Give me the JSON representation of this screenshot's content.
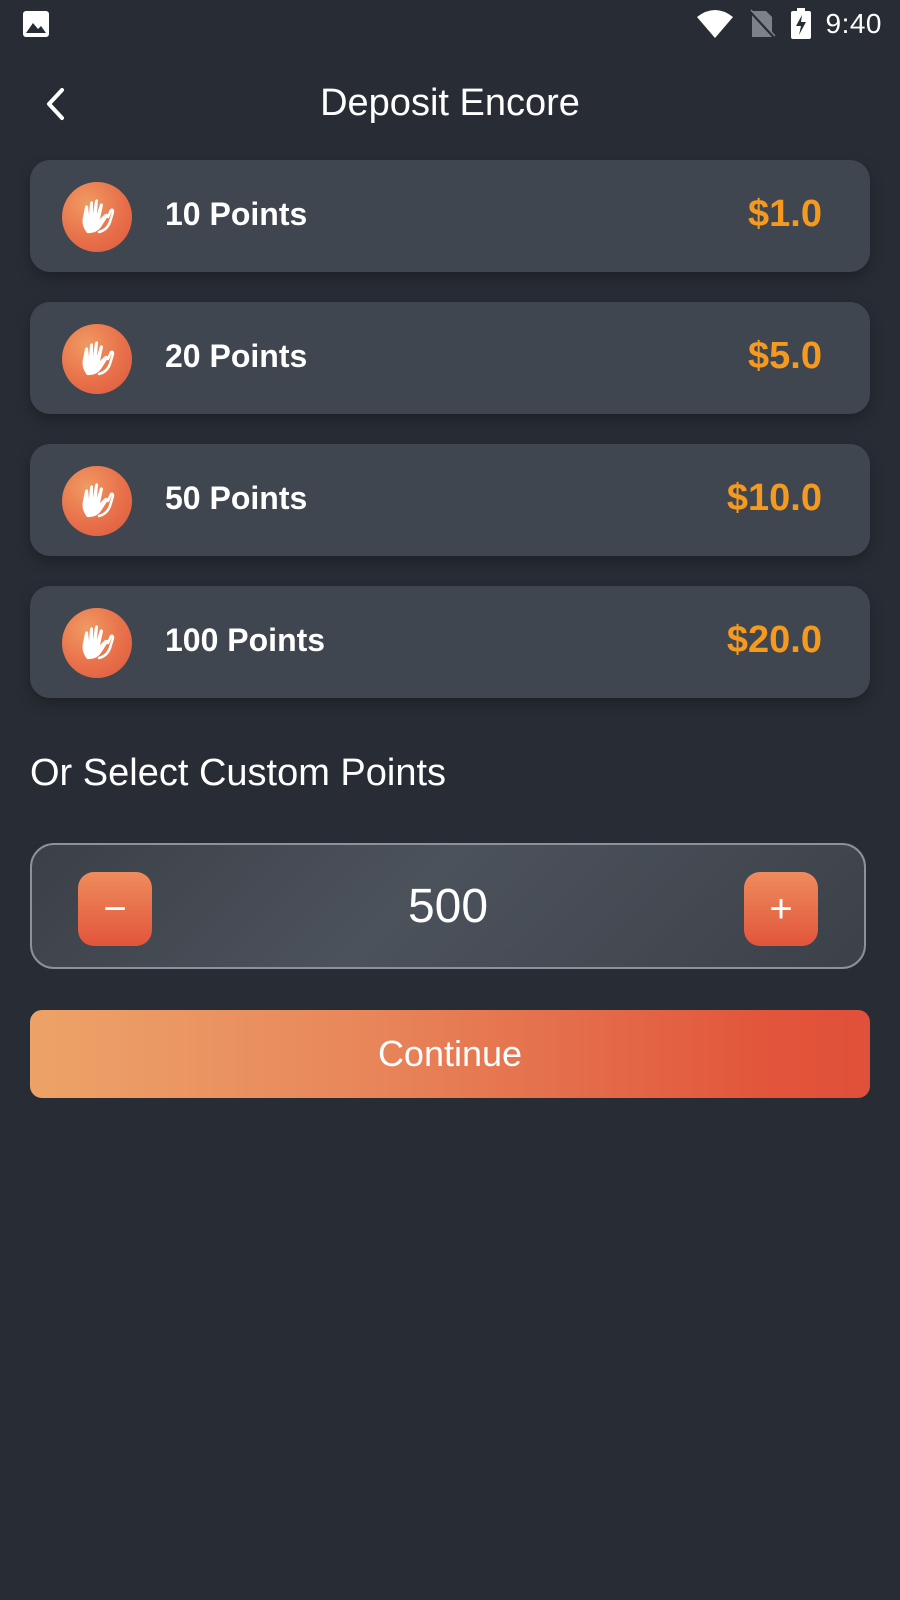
{
  "status_bar": {
    "time": "9:40",
    "left_icon": "image-icon",
    "icons": [
      "wifi-icon",
      "no-sim-icon",
      "battery-charging-icon"
    ]
  },
  "header": {
    "title": "Deposit Encore",
    "back_icon": "chevron-left-icon"
  },
  "packages": [
    {
      "label": "10 Points",
      "price": "$1.0",
      "icon": "clapping-hands-icon"
    },
    {
      "label": "20 Points",
      "price": "$5.0",
      "icon": "clapping-hands-icon"
    },
    {
      "label": "50 Points",
      "price": "$10.0",
      "icon": "clapping-hands-icon"
    },
    {
      "label": "100 Points",
      "price": "$20.0",
      "icon": "clapping-hands-icon"
    }
  ],
  "custom": {
    "title": "Or Select Custom Points",
    "value": "500",
    "minus_label": "−",
    "plus_label": "+"
  },
  "continue_label": "Continue",
  "colors": {
    "background": "#282d35",
    "card": "#3f4650",
    "price": "#f59a1e",
    "accent_start": "#eca367",
    "accent_end": "#e1503a"
  }
}
